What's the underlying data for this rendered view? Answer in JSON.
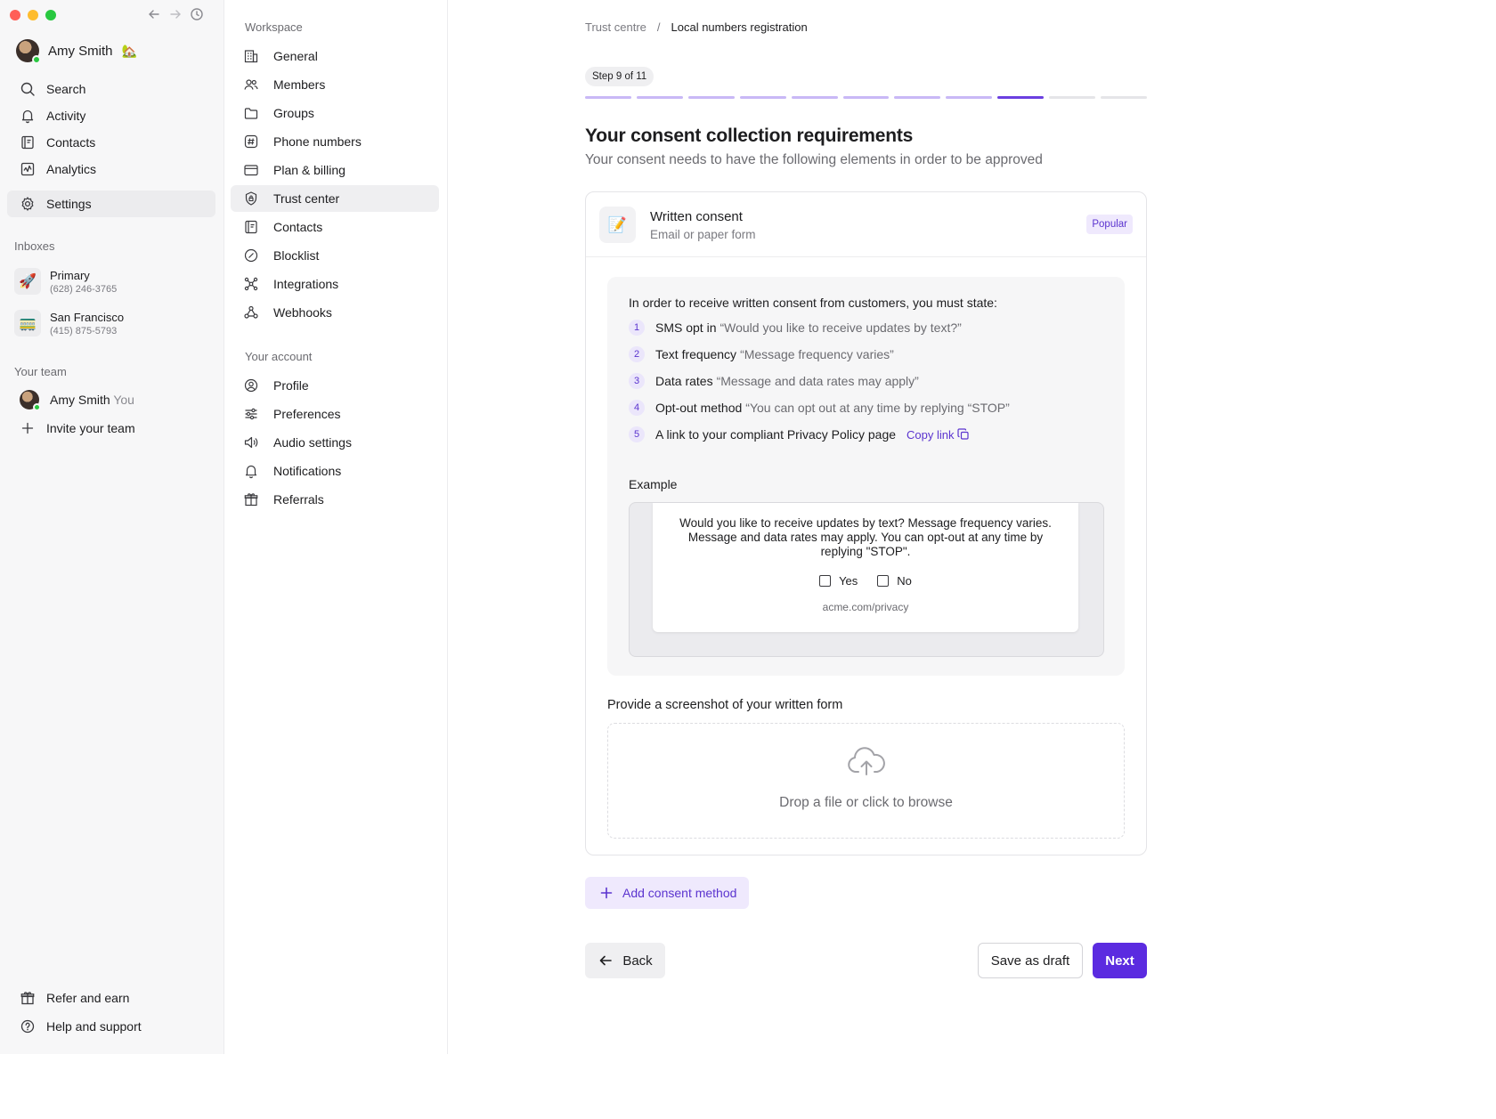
{
  "user": {
    "name": "Amy Smith",
    "emoji": "🏡"
  },
  "rail": {
    "items": [
      {
        "label": "Search",
        "icon": "search-icon"
      },
      {
        "label": "Activity",
        "icon": "bell-icon"
      },
      {
        "label": "Contacts",
        "icon": "contacts-icon"
      },
      {
        "label": "Analytics",
        "icon": "analytics-icon"
      },
      {
        "label": "Settings",
        "icon": "gear-icon",
        "active": true
      }
    ],
    "inboxes_label": "Inboxes",
    "inboxes": [
      {
        "name": "Primary",
        "number": "(628) 246-3765",
        "emoji": "🚀"
      },
      {
        "name": "San Francisco",
        "number": "(415) 875-5793",
        "emoji": "🚃"
      }
    ],
    "team_label": "Your team",
    "team_member": {
      "name": "Amy Smith",
      "tag": "You"
    },
    "invite": "Invite your team",
    "footer": [
      "Refer and earn",
      "Help and support"
    ]
  },
  "settings_nav": {
    "workspace_label": "Workspace",
    "workspace": [
      "General",
      "Members",
      "Groups",
      "Phone numbers",
      "Plan & billing",
      "Trust center",
      "Contacts",
      "Blocklist",
      "Integrations",
      "Webhooks"
    ],
    "account_label": "Your account",
    "account": [
      "Profile",
      "Preferences",
      "Audio settings",
      "Notifications",
      "Referrals"
    ],
    "active": "Trust center"
  },
  "breadcrumb": {
    "parent": "Trust centre",
    "sep": "/",
    "current": "Local numbers registration"
  },
  "step": {
    "label": "Step 9 of 11",
    "current": 9,
    "total": 11
  },
  "page": {
    "title": "Your consent collection requirements",
    "subtitle": "Your consent needs to have the following elements in order to be approved"
  },
  "consent_card": {
    "title": "Written consent",
    "subtitle": "Email or paper form",
    "badge": "Popular",
    "icon_emoji": "📝",
    "intro": "In order to receive written consent from customers, you must state:",
    "requirements": [
      {
        "n": "1",
        "key": "SMS opt in",
        "value": "“Would you like to receive updates by text?”"
      },
      {
        "n": "2",
        "key": "Text frequency",
        "value": "“Message frequency varies”"
      },
      {
        "n": "3",
        "key": "Data rates",
        "value": "“Message and data rates may apply”"
      },
      {
        "n": "4",
        "key": "Opt-out method",
        "value": "“You can opt out at any time by replying “STOP”"
      },
      {
        "n": "5",
        "key": "A link to your compliant Privacy Policy page",
        "value": ""
      }
    ],
    "copy_link": "Copy link",
    "example_label": "Example",
    "example_text": "Would you like to receive updates by text? Message frequency varies. Message and data rates may apply. You can opt-out at any time by replying \"STOP\".",
    "example_yes": "Yes",
    "example_no": "No",
    "example_url": "acme.com/privacy",
    "upload_label": "Provide a screenshot of your written form",
    "upload_hint": "Drop a file or click to browse"
  },
  "actions": {
    "add_method": "Add consent method",
    "back": "Back",
    "save_draft": "Save as draft",
    "next": "Next"
  },
  "colors": {
    "accent": "#5b2be0",
    "accent_soft": "#efe9fd"
  }
}
